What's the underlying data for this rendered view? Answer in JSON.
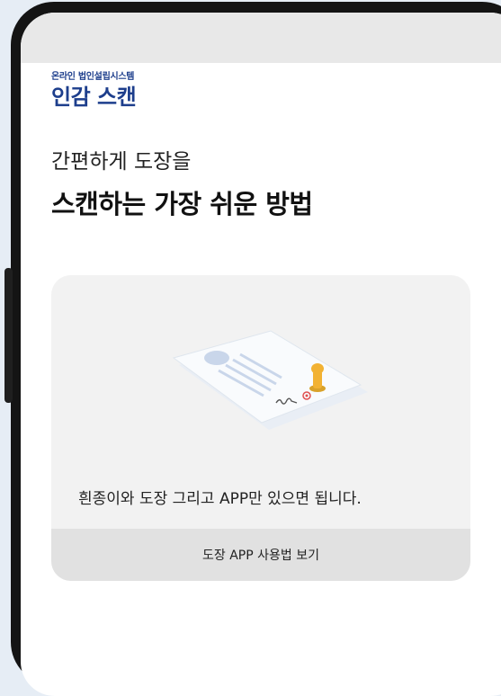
{
  "header": {
    "subtitle": "온라인 법인설립시스템",
    "title": "인감 스캔"
  },
  "headline": {
    "line1": "간편하게 도장을",
    "line2": "스캔하는 가장 쉬운 방법"
  },
  "card": {
    "description": "흰종이와 도장 그리고 APP만 있으면 됩니다.",
    "button_label": "도장 APP 사용법 보기",
    "illustration_icon": "document-with-stamp-icon"
  },
  "colors": {
    "brand": "#1d3e8c",
    "stamp_handle": "#f2b233",
    "stamp_mark": "#e05050"
  }
}
